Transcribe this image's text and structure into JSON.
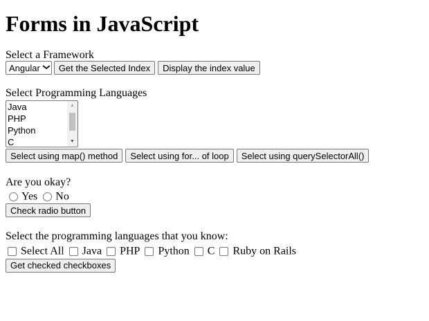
{
  "page": {
    "title": "Forms in JavaScript"
  },
  "framework": {
    "label": "Select a Framework",
    "selected": "Angular",
    "buttons": {
      "selected_index": "Get the Selected Index",
      "display_index": "Display the index value"
    }
  },
  "languages_list": {
    "label": "Select Programming Languages",
    "options": [
      "Java",
      "PHP",
      "Python",
      "C"
    ],
    "buttons": {
      "map": "Select using map() method",
      "forof": "Select using for... of loop",
      "qsa": "Select using querySelectorAll()"
    }
  },
  "okay": {
    "label": "Are you okay?",
    "options": [
      "Yes",
      "No"
    ],
    "button": "Check radio button"
  },
  "known_languages": {
    "label": "Select the programming languages that you know:",
    "options": [
      "Select All",
      "Java",
      "PHP",
      "Python",
      "C",
      "Ruby on Rails"
    ],
    "button": "Get checked checkboxes"
  }
}
